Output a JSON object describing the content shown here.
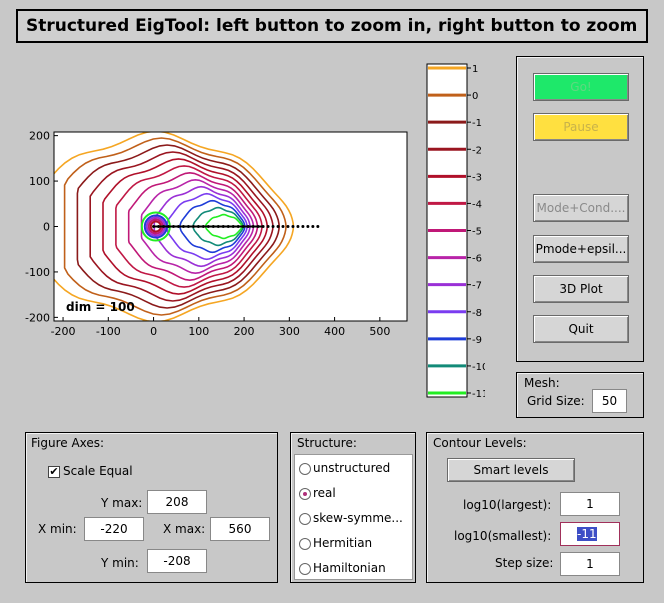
{
  "title": "Structured EigTool: left button to zoom in, right button to zoom",
  "plot": {
    "dim_label": "dim = 100",
    "x_ticks": [
      "-200",
      "-100",
      "0",
      "100",
      "200",
      "300",
      "400",
      "500"
    ],
    "y_ticks": [
      "200",
      "100",
      "0",
      "-100",
      "-200"
    ]
  },
  "colorbar": {
    "levels": [
      "1",
      "0",
      "-1",
      "-2",
      "-3",
      "-4",
      "-5",
      "-6",
      "-7",
      "-8",
      "-9",
      "-10",
      "-11"
    ],
    "colors": [
      "#f5a623",
      "#c0601a",
      "#8b1a1a",
      "#9a1520",
      "#b0102a",
      "#c01845",
      "#c01877",
      "#b824a8",
      "#9a30d6",
      "#7a3cf0",
      "#1e3cd8",
      "#128a78",
      "#22ee22"
    ]
  },
  "buttons": {
    "go": "Go!",
    "pause": "Pause",
    "mode_cond": "Mode+Cond....",
    "pmode_epsil": "Pmode+epsil...",
    "plot3d": "3D Plot",
    "quit": "Quit"
  },
  "colors": {
    "go": "#1ee86a",
    "pause": "#ffe040",
    "go_text": "#60d880",
    "pause_text": "#c8b24a"
  },
  "mesh": {
    "label": "Mesh:",
    "grid_size_label": "Grid Size:",
    "grid_size": "50"
  },
  "figure_axes": {
    "title": "Figure Axes:",
    "scale_equal": "Scale Equal",
    "scale_checked": "✔",
    "ymax_label": "Y max:",
    "ymax": "208",
    "xmin_label": "X min:",
    "xmin": "-220",
    "xmax_label": "X max:",
    "xmax": "560",
    "ymin_label": "Y min:",
    "ymin": "-208"
  },
  "structure": {
    "title": "Structure:",
    "options": [
      "unstructured",
      "real",
      "skew-symme...",
      "Hermitian",
      "Hamiltonian"
    ],
    "selected": "real"
  },
  "contour": {
    "title": "Contour Levels:",
    "smart_levels": "Smart  levels",
    "largest_label": "log10(largest):",
    "largest": "1",
    "smallest_label": "log10(smallest):",
    "smallest": "-11",
    "step_label": "Step size:",
    "step": "1"
  }
}
